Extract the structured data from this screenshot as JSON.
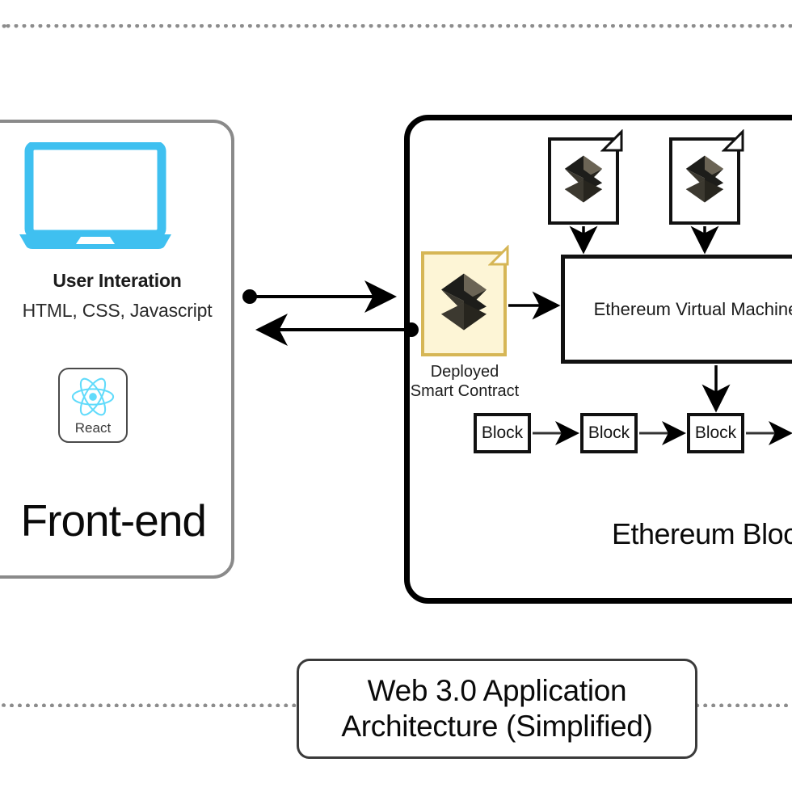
{
  "diagram": {
    "title_lines": [
      "Web 3.0 Application",
      "Architecture (Simplified)"
    ],
    "boundary": {
      "style": "dotted",
      "color": "#8c8c8c"
    }
  },
  "frontend": {
    "panel_title": "Front-end",
    "laptop_icon": "laptop-icon",
    "heading": "User Interation",
    "subheading": "HTML, CSS, Javascript",
    "framework_badge": {
      "icon": "react-atom-icon",
      "label": "React",
      "color": "#61DBFB"
    },
    "border_color": "#8a8a8a",
    "accent_color": "#3FC0F0"
  },
  "blockchain": {
    "panel_title": "Ethereum Bloc",
    "border_color": "#000000",
    "evm": {
      "label": "Ethereum Virtual Machine"
    },
    "contracts": [
      {
        "icon": "ethereum-contract-document-icon"
      },
      {
        "icon": "ethereum-contract-document-icon"
      }
    ],
    "deployed_contract": {
      "icon": "ethereum-contract-document-icon",
      "label_lines": [
        "Deployed",
        "Smart Contract"
      ],
      "fill_color": "#fdf5d6",
      "border_color": "#d6b656"
    },
    "blocks": [
      {
        "label": "Block"
      },
      {
        "label": "Block"
      },
      {
        "label": "Block"
      }
    ]
  }
}
